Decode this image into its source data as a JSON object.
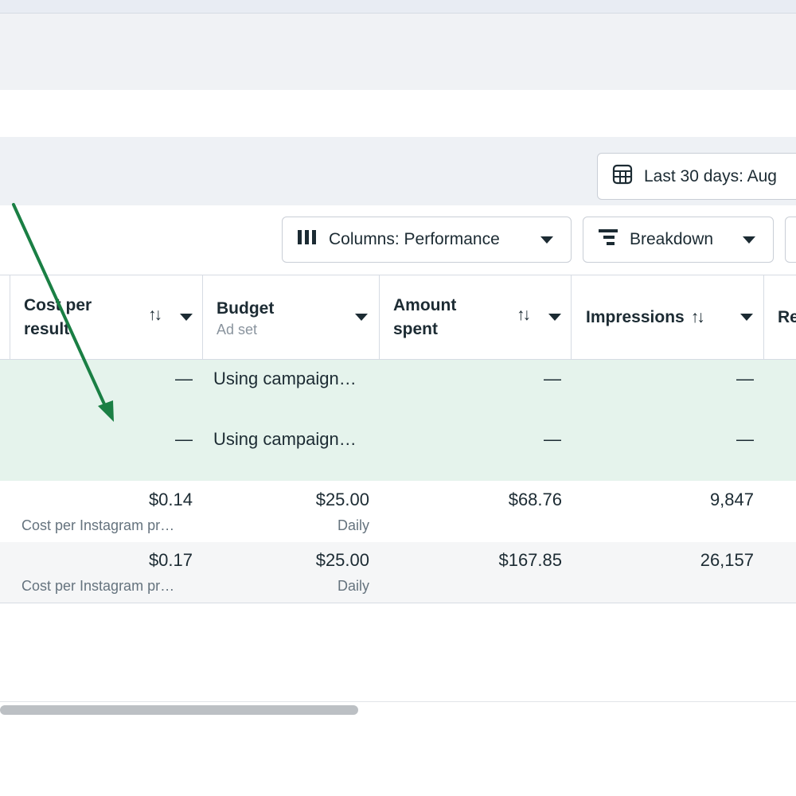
{
  "toolbar": {
    "date_range_label": "Last 30 days: Aug",
    "columns_label": "Columns: Performance",
    "breakdown_label": "Breakdown"
  },
  "table": {
    "headers": {
      "cost_per_result_line1": "Cost per",
      "cost_per_result_line2": "result",
      "budget": "Budget",
      "budget_sub": "Ad set",
      "amount_spent_line1": "Amount",
      "amount_spent_line2": "spent",
      "impressions": "Impressions",
      "reach_partial": "Re"
    },
    "sort_icon": "↑↓",
    "rows": [
      {
        "cost": "—",
        "budget": "Using campaign…",
        "spent": "—",
        "impressions": "—"
      },
      {
        "cost": "—",
        "budget": "Using campaign…",
        "spent": "—",
        "impressions": "—"
      },
      {
        "cost": "$0.14",
        "cost_sub": "Cost per Instagram pr…",
        "budget": "$25.00",
        "budget_sub": "Daily",
        "spent": "$68.76",
        "impressions": "9,847"
      },
      {
        "cost": "$0.17",
        "cost_sub": "Cost per Instagram pr…",
        "budget": "$25.00",
        "budget_sub": "Daily",
        "spent": "$167.85",
        "impressions": "26,157"
      }
    ]
  },
  "icons": {
    "date": "calendar-table-icon",
    "columns": "columns-icon",
    "breakdown": "breakdown-icon"
  },
  "colors": {
    "annotation_arrow": "#1a7f44",
    "highlight_row": "#e5f3ec"
  }
}
